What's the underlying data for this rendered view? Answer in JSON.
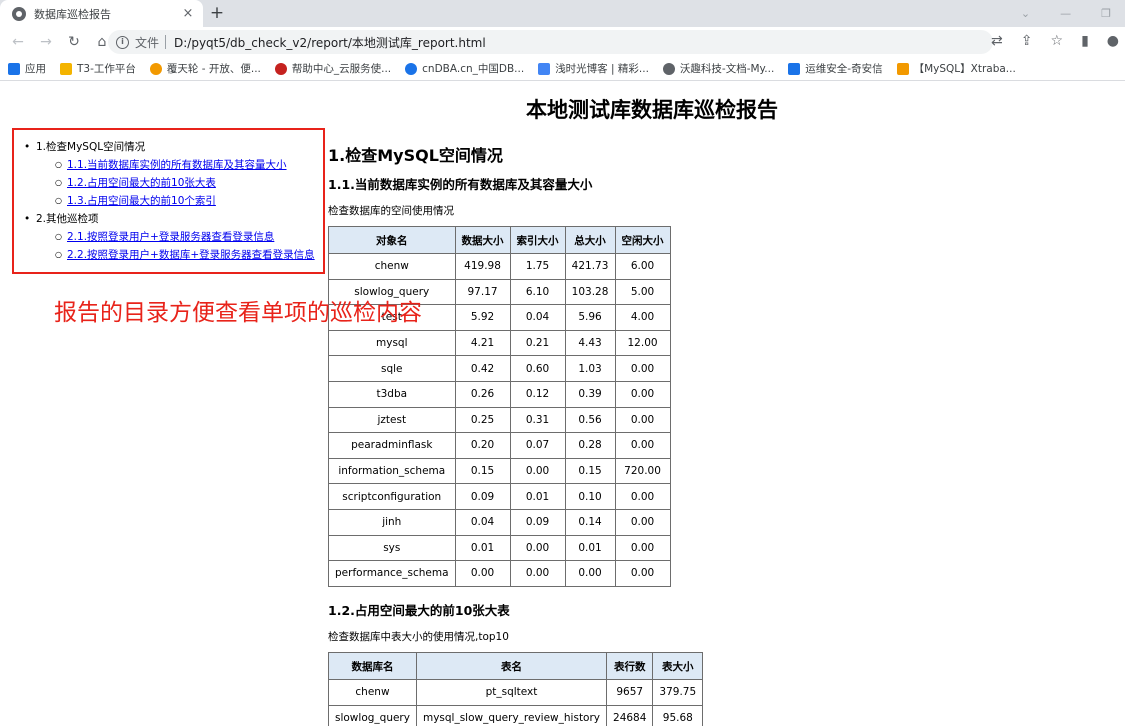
{
  "browser": {
    "tab_title": "数据库巡检报告",
    "tab_close": "×",
    "new_tab": "+",
    "scheme_label": "文件",
    "url": "D:/pyqt5/db_check_v2/report/本地测试库_report.html",
    "bookmarks": [
      {
        "label": "应用",
        "icon_color": "#1a73e8"
      },
      {
        "label": "T3-工作平台",
        "icon_color": "#f4b400"
      },
      {
        "label": "覆天轮 - 开放、便...",
        "icon_color": "#f29900"
      },
      {
        "label": "帮助中心_云服务使...",
        "icon_color": "#c5221f"
      },
      {
        "label": "cnDBA.cn_中国DB...",
        "icon_color": "#1a73e8"
      },
      {
        "label": "浅时光博客 | 精彩...",
        "icon_color": "#4285f4"
      },
      {
        "label": "沃趣科技-文档-My...",
        "icon_color": "#5f6368"
      },
      {
        "label": "运维安全-奇安信",
        "icon_color": "#1a73e8"
      },
      {
        "label": "【MySQL】Xtraba...",
        "icon_color": "#f29900"
      }
    ]
  },
  "report": {
    "title": "本地测试库数据库巡检报告",
    "toc": [
      {
        "label": "1.检查MySQL空间情况",
        "items": [
          "1.1.当前数据库实例的所有数据库及其容量大小",
          "1.2.占用空间最大的前10张大表",
          "1.3.占用空间最大的前10个索引"
        ]
      },
      {
        "label": "2.其他巡检项",
        "items": [
          "2.1.按照登录用户+登录服务器查看登录信息",
          "2.2.按照登录用户+数据库+登录服务器查看登录信息"
        ]
      }
    ],
    "annotation": "报告的目录方便查看单项的巡检内容",
    "section1": {
      "heading": "1.检查MySQL空间情况",
      "sub1": {
        "heading": "1.1.当前数据库实例的所有数据库及其容量大小",
        "desc": "检查数据库的空间使用情况",
        "columns": [
          "对象名",
          "数据大小",
          "索引大小",
          "总大小",
          "空闲大小"
        ],
        "rows": [
          [
            "chenw",
            "419.98",
            "1.75",
            "421.73",
            "6.00"
          ],
          [
            "slowlog_query",
            "97.17",
            "6.10",
            "103.28",
            "5.00"
          ],
          [
            "test",
            "5.92",
            "0.04",
            "5.96",
            "4.00"
          ],
          [
            "mysql",
            "4.21",
            "0.21",
            "4.43",
            "12.00"
          ],
          [
            "sqle",
            "0.42",
            "0.60",
            "1.03",
            "0.00"
          ],
          [
            "t3dba",
            "0.26",
            "0.12",
            "0.39",
            "0.00"
          ],
          [
            "jztest",
            "0.25",
            "0.31",
            "0.56",
            "0.00"
          ],
          [
            "pearadminflask",
            "0.20",
            "0.07",
            "0.28",
            "0.00"
          ],
          [
            "information_schema",
            "0.15",
            "0.00",
            "0.15",
            "720.00"
          ],
          [
            "scriptconfiguration",
            "0.09",
            "0.01",
            "0.10",
            "0.00"
          ],
          [
            "jinh",
            "0.04",
            "0.09",
            "0.14",
            "0.00"
          ],
          [
            "sys",
            "0.01",
            "0.00",
            "0.01",
            "0.00"
          ],
          [
            "performance_schema",
            "0.00",
            "0.00",
            "0.00",
            "0.00"
          ]
        ]
      },
      "sub2": {
        "heading": "1.2.占用空间最大的前10张大表",
        "desc": "检查数据库中表大小的使用情况,top10",
        "columns": [
          "数据库名",
          "表名",
          "表行数",
          "表大小"
        ],
        "rows": [
          [
            "chenw",
            "pt_sqltext",
            "9657",
            "379.75"
          ],
          [
            "slowlog_query",
            "mysql_slow_query_review_history",
            "24684",
            "95.68"
          ]
        ]
      }
    }
  }
}
